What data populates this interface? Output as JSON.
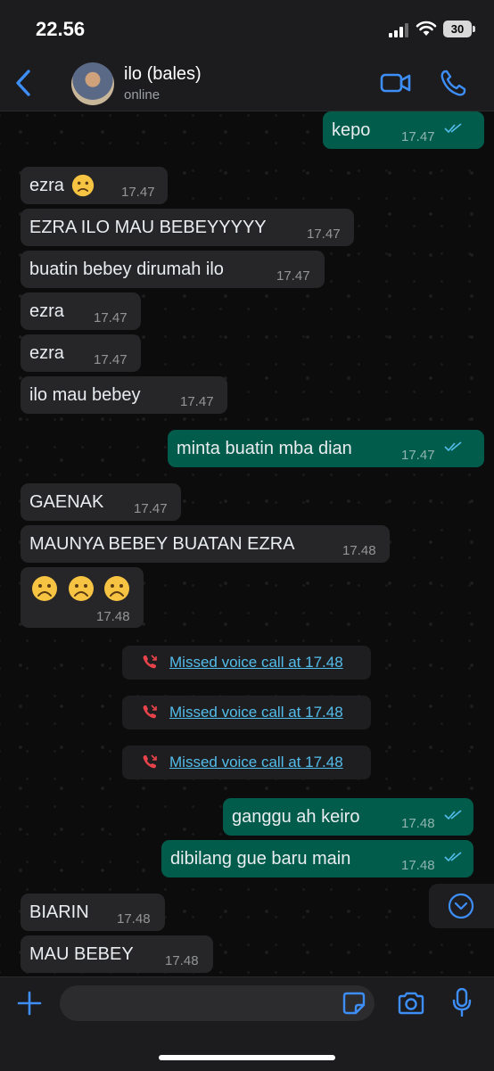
{
  "status_bar": {
    "time": "22.56",
    "battery": "30"
  },
  "header": {
    "contact_name": "ilo (bales)",
    "contact_status": "online"
  },
  "messages": [
    {
      "text": "kepo",
      "time": "17.47"
    },
    {
      "text": "ezra",
      "time": "17.47"
    },
    {
      "text": "EZRA ILO MAU BEBEYYYYY",
      "time": "17.47"
    },
    {
      "text": "buatin bebey dirumah ilo",
      "time": "17.47"
    },
    {
      "text": "ezra",
      "time": "17.47"
    },
    {
      "text": "ezra",
      "time": "17.47"
    },
    {
      "text": "ilo mau bebey",
      "time": "17.47"
    },
    {
      "text": "minta buatin mba dian",
      "time": "17.47"
    },
    {
      "text": "GAENAK",
      "time": "17.47"
    },
    {
      "text": "MAUNYA BEBEY BUATAN EZRA",
      "time": "17.48"
    },
    {
      "emoji": "☹️☹️☹️",
      "time": "17.48"
    },
    {
      "text": "ganggu ah keiro",
      "time": "17.48"
    },
    {
      "text": "dibilang gue baru main",
      "time": "17.48"
    },
    {
      "text": "BIARIN",
      "time": "17.48"
    },
    {
      "text": "MAU BEBEY",
      "time": "17.48"
    }
  ],
  "missed_calls": [
    {
      "text": "Missed voice call at 17.48"
    },
    {
      "text": "Missed voice call at 17.48"
    },
    {
      "text": "Missed voice call at 17.48"
    }
  ],
  "colors": {
    "accent": "#3e8ef7",
    "incoming_bubble": "#262628",
    "outgoing_bubble": "#025c4c",
    "missed_call_icon": "#e8424a",
    "missed_call_link": "#53bdeb",
    "read_ticks": "#53bdeb"
  },
  "icons": {
    "back": "chevron-left-icon",
    "video": "video-camera-icon",
    "call": "phone-icon",
    "attach": "plus-icon",
    "sticker": "sticker-icon",
    "camera": "camera-icon",
    "mic": "microphone-icon",
    "scroll": "chevron-down-circle-icon",
    "missed_call": "missed-call-icon",
    "read": "double-check-icon",
    "sad_emoji": "frowning-face-icon",
    "slightly_sad_emoji": "slightly-frowning-face-icon"
  }
}
